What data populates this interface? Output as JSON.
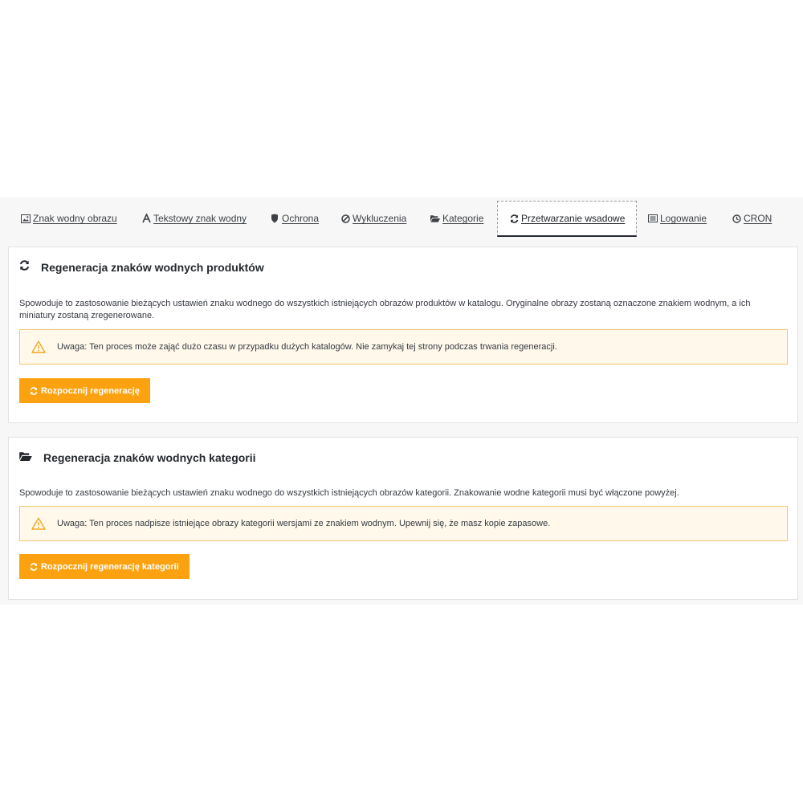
{
  "tabs": [
    {
      "label": "Znak wodny obrazu",
      "icon": "image-icon"
    },
    {
      "label": "Tekstowy znak wodny",
      "icon": "font-icon"
    },
    {
      "label": "Ochrona",
      "icon": "shield-icon"
    },
    {
      "label": "Wykluczenia",
      "icon": "ban-icon"
    },
    {
      "label": "Kategorie",
      "icon": "folder-open-icon"
    },
    {
      "label": "Przetwarzanie wsadowe",
      "icon": "refresh-icon",
      "active": true
    },
    {
      "label": "Logowanie",
      "icon": "list-icon"
    },
    {
      "label": "CRON",
      "icon": "clock-icon"
    }
  ],
  "products": {
    "title": "Regeneracja znaków wodnych produktów",
    "description": "Spowoduje to zastosowanie bieżących ustawień znaku wodnego do wszystkich istniejących obrazów produktów w katalogu. Oryginalne obrazy zostaną oznaczone znakiem wodnym, a ich miniatury zostaną zregenerowane.",
    "warning": "Uwaga: Ten proces może zająć dużo czasu w przypadku dużych katalogów. Nie zamykaj tej strony podczas trwania regeneracji.",
    "button": "Rozpocznij regenerację"
  },
  "categories": {
    "title": "Regeneracja znaków wodnych kategorii",
    "description": "Spowoduje to zastosowanie bieżących ustawień znaku wodnego do wszystkich istniejących obrazów kategorii. Znakowanie wodne kategorii musi być włączone powyżej.",
    "warning": "Uwaga: Ten proces nadpisze istniejące obrazy kategorii wersjami ze znakiem wodnym. Upewnij się, że masz kopie zapasowe.",
    "button": "Rozpocznij regenerację kategorii"
  },
  "colors": {
    "accent": "#fca211",
    "warning_bg": "#fff8eb",
    "warning_border": "#f3c771"
  }
}
